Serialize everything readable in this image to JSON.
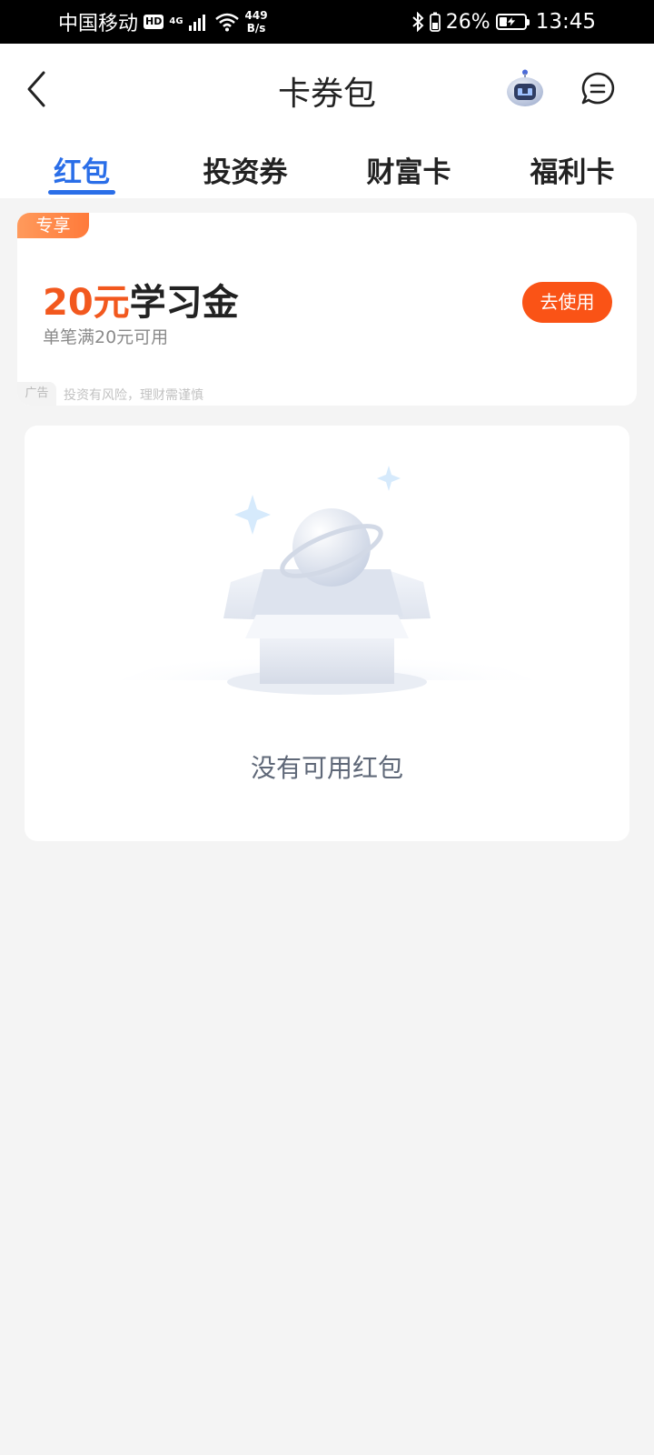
{
  "status_bar": {
    "carrier": "中国移动",
    "hd_badge": "HD",
    "network_type": "4G",
    "net_speed_value": "449",
    "net_speed_unit": "B/s",
    "battery_percent": "26%",
    "time": "13:45"
  },
  "nav": {
    "title": "卡券包"
  },
  "tabs": [
    {
      "label": "红包",
      "active": true
    },
    {
      "label": "投资券",
      "active": false
    },
    {
      "label": "财富卡",
      "active": false
    },
    {
      "label": "福利卡",
      "active": false
    }
  ],
  "coupon": {
    "tag": "专享",
    "amount": "20元",
    "name": "学习金",
    "condition": "单笔满20元可用",
    "action_label": "去使用",
    "ad_label": "广告",
    "disclaimer": "投资有风险，理财需谨慎"
  },
  "empty_state": {
    "message": "没有可用红包"
  },
  "colors": {
    "accent_blue": "#2a6ee8",
    "accent_orange": "#f2581e",
    "button_orange": "#fa5316",
    "page_background": "#f4f4f4"
  }
}
